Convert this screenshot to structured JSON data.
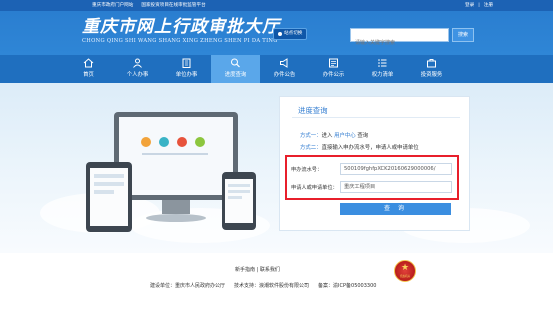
{
  "topbar": {
    "links": [
      "重庆市政府门户网站",
      "国家投资项目在线审批监管平台"
    ],
    "login": "登录",
    "divider": "|",
    "register": "注册"
  },
  "header": {
    "title": "重庆市网上行政审批大厅",
    "subtitle": "CHONG QING SHI WANG SHANG XING ZHENG SHEN PI DA TING",
    "switch_label": "站点切换",
    "search_placeholder": "请输入关键字搜索",
    "search_button": "搜索"
  },
  "nav": {
    "items": [
      {
        "label": "首页",
        "icon": "home-icon"
      },
      {
        "label": "个人办事",
        "icon": "person-icon"
      },
      {
        "label": "单位办事",
        "icon": "building-icon"
      },
      {
        "label": "进度查询",
        "icon": "search-icon",
        "active": true
      },
      {
        "label": "办件公告",
        "icon": "announce-icon"
      },
      {
        "label": "办件公示",
        "icon": "publicity-icon"
      },
      {
        "label": "权力清单",
        "icon": "list-icon"
      },
      {
        "label": "投资服务",
        "icon": "investment-icon"
      }
    ]
  },
  "panel": {
    "title": "进度查询",
    "method1_label": "方式一：",
    "method1_text_a": "进入",
    "method1_link": "用户中心",
    "method1_text_b": "查询",
    "method2_label": "方式二：",
    "method2_text": "直接输入申办流水号，申请人或申请单位",
    "serial_label": "申办流水号：",
    "serial_value": "500109fghfpXCK20160629000006/",
    "applicant_label": "申请人或申请单位：",
    "applicant_value": "重庆工程项目",
    "query_button": "查 询"
  },
  "footer": {
    "guide": "新手指南",
    "sep": "|",
    "contact": "联系我们",
    "host": "建设单位：重庆市人民政府办公厅",
    "support": "技术支持：浪潮软件股份有限公司",
    "icp": "备案：渝ICP备05003300",
    "badge_caption": "党政机关"
  },
  "colors": {
    "primary": "#2f86d6",
    "nav": "#1f6fbf",
    "highlight": "#e81f2b",
    "button": "#3b8ee0"
  }
}
